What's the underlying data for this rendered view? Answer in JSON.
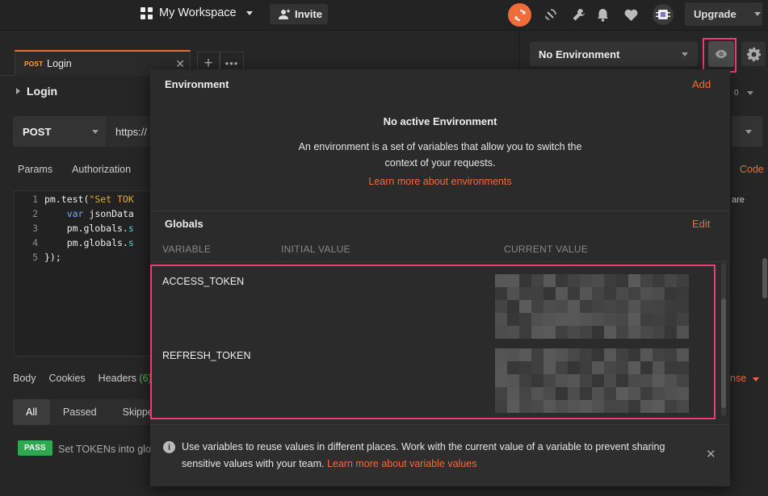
{
  "header": {
    "workspace": "My Workspace",
    "invite": "Invite",
    "upgrade": "Upgrade"
  },
  "tabs": {
    "active_method": "POST",
    "active_label": "Login"
  },
  "environment": {
    "selected": "No Environment"
  },
  "request": {
    "name": "Login",
    "method": "POST",
    "url_visible": "https://",
    "subtabs": [
      "Params",
      "Authorization"
    ],
    "code_link": "Code",
    "share_text": "are",
    "counter": "0"
  },
  "editor": {
    "lines": [
      {
        "num": "1",
        "parts": [
          {
            "t": "pm.test(",
            "c": ""
          },
          {
            "t": "\"Set TOK",
            "c": "str"
          }
        ]
      },
      {
        "num": "2",
        "parts": [
          {
            "t": "    ",
            "c": ""
          },
          {
            "t": "var",
            "c": "kw"
          },
          {
            "t": " jsonData",
            "c": ""
          }
        ]
      },
      {
        "num": "3",
        "parts": [
          {
            "t": "    pm.globals.",
            "c": ""
          },
          {
            "t": "s",
            "c": "prop"
          }
        ]
      },
      {
        "num": "4",
        "parts": [
          {
            "t": "    pm.globals.",
            "c": ""
          },
          {
            "t": "s",
            "c": "prop"
          }
        ]
      },
      {
        "num": "5",
        "parts": [
          {
            "t": "});",
            "c": ""
          }
        ]
      }
    ]
  },
  "response": {
    "tabs": {
      "body": "Body",
      "cookies": "Cookies",
      "headers": "Headers",
      "headers_count": "(6)"
    },
    "filters": [
      "All",
      "Passed",
      "Skipped"
    ],
    "active_filter": "All",
    "badge": "PASS",
    "test_name": "Set TOKENs into glob",
    "right_link": "nse"
  },
  "popover": {
    "env_title": "Environment",
    "env_add": "Add",
    "no_active_title": "No active Environment",
    "no_active_desc": "An environment is a set of variables that allow you to switch the context of your requests.",
    "learn_env": "Learn more about environments",
    "globals_title": "Globals",
    "globals_edit": "Edit",
    "columns": {
      "variable": "VARIABLE",
      "initial": "INITIAL VALUE",
      "current": "CURRENT VALUE"
    },
    "variables": [
      {
        "name": "ACCESS_TOKEN",
        "initial": "",
        "current": ""
      },
      {
        "name": "REFRESH_TOKEN",
        "initial": "",
        "current": ""
      }
    ],
    "info_text": "Use variables to reuse values in different places. Work with the current value of a variable to prevent sharing sensitive values with your team.",
    "info_link": "Learn more about variable values"
  },
  "colors": {
    "accent": "#f26b3a",
    "highlight": "#ea3e72",
    "pass": "#2fa84f",
    "background": "#262626",
    "popover": "#2b2b2b"
  },
  "icons": [
    "grid-icon",
    "add-person-icon",
    "sync-icon",
    "satellite-icon",
    "wrench-icon",
    "bell-icon",
    "heart-icon",
    "avatar-icon",
    "eye-icon",
    "gear-icon",
    "info-icon",
    "close-icon"
  ]
}
